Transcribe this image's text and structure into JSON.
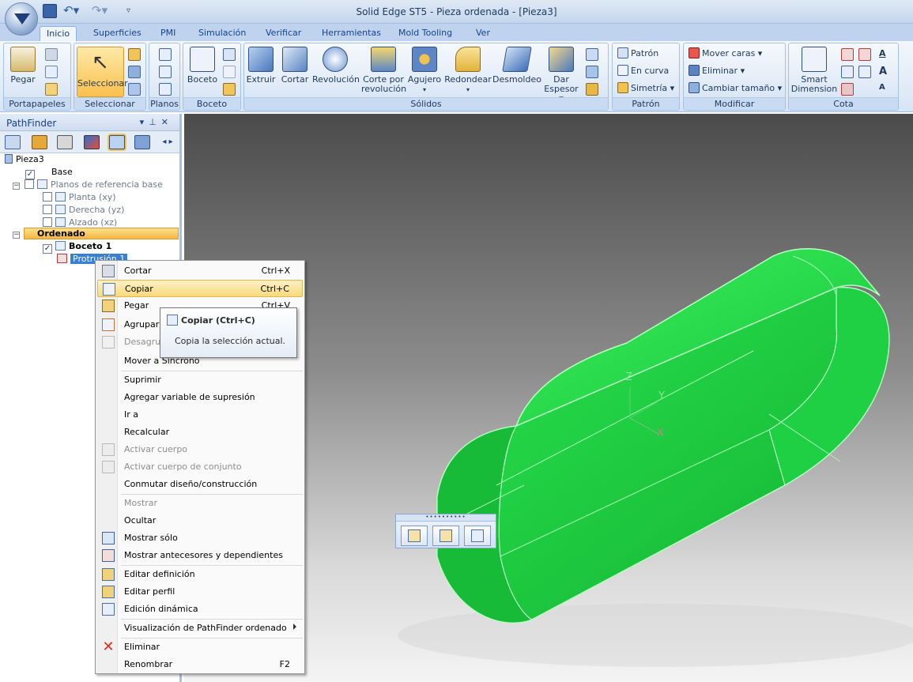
{
  "window": {
    "title": "Solid Edge ST5 - Pieza ordenada - [Pieza3]"
  },
  "ribbon_tabs": [
    "Inicio",
    "Superficies",
    "PMI",
    "Simulación",
    "Verificar",
    "Herramientas",
    "Mold Tooling",
    "Ver"
  ],
  "ribbon": {
    "portapapeles": {
      "label": "Portapapeles",
      "paste": "Pegar"
    },
    "seleccionar": {
      "label": "Seleccionar",
      "select": "Seleccionar"
    },
    "planos": {
      "label": "Planos"
    },
    "boceto": {
      "label": "Boceto",
      "sketch": "Boceto"
    },
    "solidos": {
      "label": "Sólidos",
      "extrude": "Extruir",
      "cut": "Cortar",
      "revolve": "Revolución",
      "revolved_cut_line1": "Corte por",
      "revolved_cut_line2": "revolución",
      "hole": "Agujero",
      "round": "Redondear",
      "draft": "Desmoldeo",
      "thin_line1": "Dar",
      "thin_line2": "Espesor"
    },
    "patron": {
      "label": "Patrón",
      "pattern": "Patrón",
      "along_curve": "En curva",
      "mirror": "Simetría"
    },
    "modificar": {
      "label": "Modificar",
      "move_faces": "Mover caras",
      "delete": "Eliminar",
      "resize": "Cambiar tamaño"
    },
    "cota": {
      "label": "Cota",
      "smart_line1": "Smart",
      "smart_line2": "Dimension"
    }
  },
  "pathfinder": {
    "title": "PathFinder",
    "tree": {
      "root": "Pieza3",
      "base": "Base",
      "ref_planes": "Planos de referencia base",
      "plane_top": "Planta (xy)",
      "plane_right": "Derecha (yz)",
      "plane_front": "Alzado (xz)",
      "ordered": "Ordenado",
      "sketch1": "Boceto 1",
      "protrusion1": "Protrusión 1"
    }
  },
  "viewport": {
    "axis_x": "X",
    "axis_y": "Y",
    "axis_z": "Z",
    "body_color": "#22e34a",
    "body_edge": "#a8ffb0"
  },
  "context_menu": {
    "items": [
      {
        "label": "Cortar",
        "shortcut": "Ctrl+X"
      },
      {
        "label": "Copiar",
        "shortcut": "Ctrl+C"
      },
      {
        "label": "Pegar",
        "shortcut": "Ctrl+V"
      },
      {
        "label": "Agrupar",
        "shortcut": ""
      },
      {
        "label": "Desagrupar",
        "shortcut": ""
      },
      {
        "label": "Mover a Síncrono",
        "shortcut": ""
      },
      {
        "label": "Suprimir",
        "shortcut": ""
      },
      {
        "label": "Agregar variable de supresión",
        "shortcut": ""
      },
      {
        "label": "Ir a",
        "shortcut": ""
      },
      {
        "label": "Recalcular",
        "shortcut": ""
      },
      {
        "label": "Activar cuerpo",
        "shortcut": ""
      },
      {
        "label": "Activar cuerpo de conjunto",
        "shortcut": ""
      },
      {
        "label": "Conmutar diseño/construcción",
        "shortcut": ""
      },
      {
        "label": "Mostrar",
        "shortcut": ""
      },
      {
        "label": "Ocultar",
        "shortcut": ""
      },
      {
        "label": "Mostrar sólo",
        "shortcut": ""
      },
      {
        "label": "Mostrar antecesores y dependientes",
        "shortcut": ""
      },
      {
        "label": "Editar definición",
        "shortcut": ""
      },
      {
        "label": "Editar perfil",
        "shortcut": ""
      },
      {
        "label": "Edición dinámica",
        "shortcut": ""
      },
      {
        "label": "Visualización de PathFinder ordenado",
        "shortcut": ""
      },
      {
        "label": "Eliminar",
        "shortcut": ""
      },
      {
        "label": "Renombrar",
        "shortcut": "F2"
      }
    ]
  },
  "tooltip": {
    "title": "Copiar  (Ctrl+C)",
    "description": "Copia la selección actual."
  }
}
